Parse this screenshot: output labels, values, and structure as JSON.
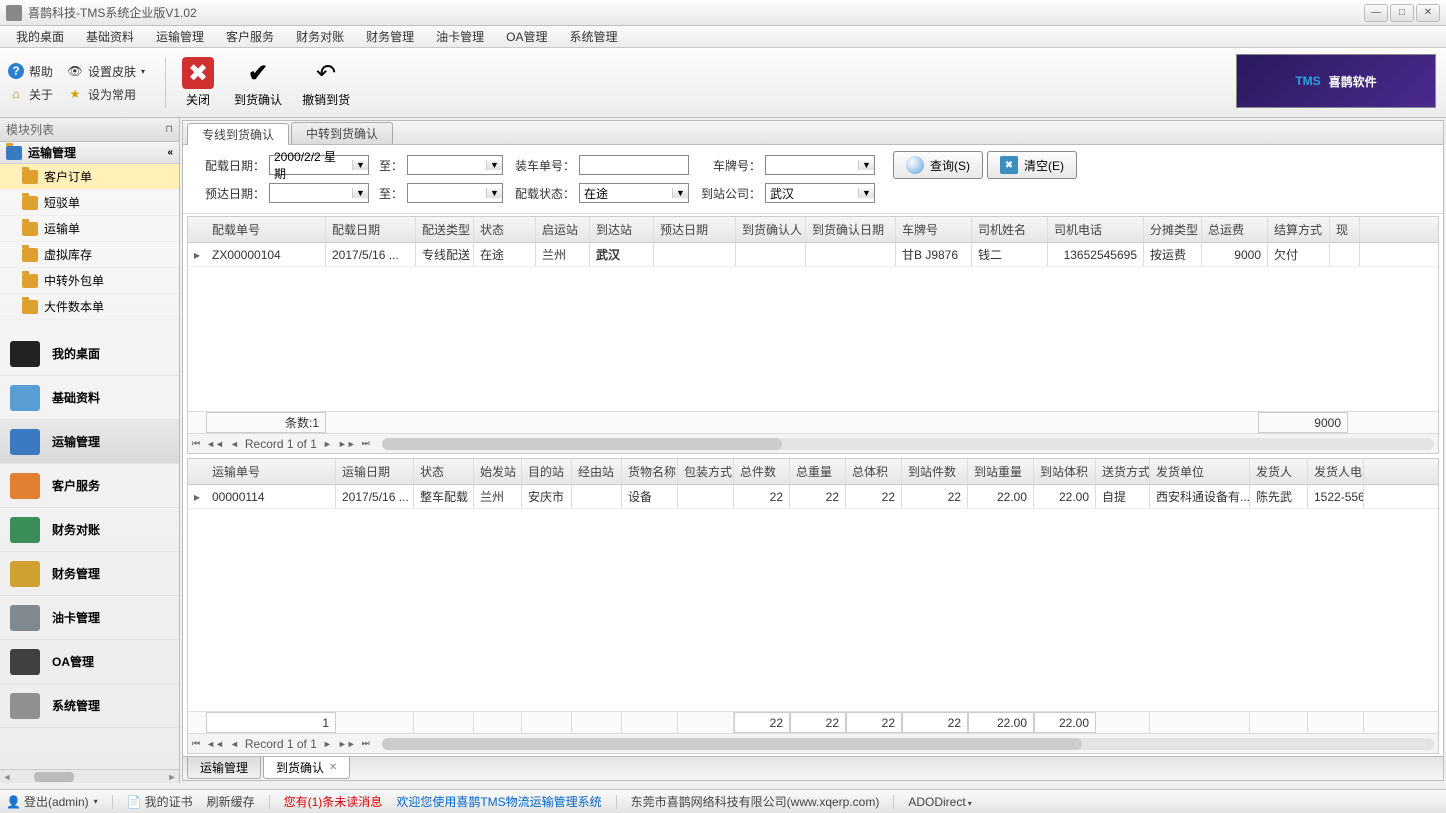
{
  "window": {
    "title": "喜鹊科技-TMS系统企业版V1.02"
  },
  "menubar": [
    "我的桌面",
    "基础资料",
    "运输管理",
    "客户服务",
    "财务对账",
    "财务管理",
    "油卡管理",
    "OA管理",
    "系统管理"
  ],
  "toolbar": {
    "help": "帮助",
    "skin": "设置皮肤",
    "about": "关于",
    "setCommon": "设为常用",
    "close": "关闭",
    "confirmArrive": "到货确认",
    "revokeArrive": "撤销到货",
    "logo_tms": "TMS",
    "logo_text": "喜鹊软件"
  },
  "sidebar": {
    "header": "模块列表",
    "expandedGroup": "运输管理",
    "tree": [
      "客户订单",
      "短驳单",
      "运输单",
      "虚拟库存",
      "中转外包单",
      "大件数本单"
    ],
    "treeSelected": 0,
    "bigNav": [
      {
        "label": "我的桌面",
        "color": "#222"
      },
      {
        "label": "基础资料",
        "color": "#5a9ed6"
      },
      {
        "label": "运输管理",
        "color": "#3a7ac0"
      },
      {
        "label": "客户服务",
        "color": "#e08030"
      },
      {
        "label": "财务对账",
        "color": "#3a8e5a"
      },
      {
        "label": "财务管理",
        "color": "#d0a030"
      },
      {
        "label": "油卡管理",
        "color": "#808890"
      },
      {
        "label": "OA管理",
        "color": "#404040"
      },
      {
        "label": "系统管理",
        "color": "#909090"
      }
    ],
    "bigNavSelected": 2
  },
  "tabs": {
    "items": [
      "专线到货确认",
      "中转到货确认"
    ],
    "active": 0
  },
  "form": {
    "labels": {
      "loadDate": "配载日期：",
      "to": "至：",
      "loadNo": "装车单号：",
      "plate": "车牌号：",
      "estDate": "预达日期：",
      "loadStatus": "配载状态：",
      "arriveCo": "到站公司："
    },
    "values": {
      "loadDateFrom": "2000/2/2 星期",
      "loadDateTo": "",
      "estFrom": "",
      "estTo": "",
      "loadNo": "",
      "plate": "",
      "loadStatus": "在途",
      "arriveCo": "武汉"
    },
    "btnSearch": "查询(S)",
    "btnClear": "清空(E)"
  },
  "grid1": {
    "headers": [
      "配载单号",
      "配载日期",
      "配送类型",
      "状态",
      "启运站",
      "到达站",
      "预达日期",
      "到货确认人",
      "到货确认日期",
      "车牌号",
      "司机姓名",
      "司机电话",
      "分摊类型",
      "总运费",
      "结算方式",
      "现"
    ],
    "widths": [
      120,
      90,
      58,
      62,
      54,
      64,
      82,
      70,
      90,
      76,
      76,
      96,
      58,
      66,
      62,
      30
    ],
    "rows": [
      {
        "cells": [
          "ZX00000104",
          "2017/5/16 ...",
          "专线配送",
          "在途",
          "兰州",
          "武汉",
          "",
          "",
          "",
          "甘B J9876",
          "钱二",
          "13652545695",
          "按运费",
          "9000",
          "欠付",
          ""
        ],
        "bold": [
          5
        ]
      }
    ],
    "summaryCount": "条数:1",
    "summaryTotal": "9000",
    "recordNav": "Record 1 of 1"
  },
  "grid2": {
    "headers": [
      "运输单号",
      "运输日期",
      "状态",
      "始发站",
      "目的站",
      "经由站",
      "货物名称",
      "包装方式",
      "总件数",
      "总重量",
      "总体积",
      "到站件数",
      "到站重量",
      "到站体积",
      "送货方式",
      "发货单位",
      "发货人",
      "发货人电"
    ],
    "widths": [
      130,
      78,
      60,
      48,
      50,
      50,
      56,
      56,
      56,
      56,
      56,
      66,
      66,
      62,
      54,
      100,
      58,
      56
    ],
    "rows": [
      {
        "cells": [
          "00000114",
          "2017/5/16 ...",
          "整车配载",
          "兰州",
          "安庆市",
          "",
          "设备",
          "",
          "22",
          "22",
          "22",
          "22",
          "22.00",
          "22.00",
          "自提",
          "西安科通设备有...",
          "陈先武",
          "1522-556"
        ]
      }
    ],
    "summaryRow": [
      "1",
      "",
      "",
      "",
      "",
      "",
      "",
      "",
      "22",
      "22",
      "22",
      "22",
      "22.00",
      "22.00",
      "",
      "",
      "",
      ""
    ],
    "recordNav": "Record 1 of 1"
  },
  "bottomTabs": {
    "items": [
      "运输管理",
      "到货确认"
    ],
    "active": 1
  },
  "statusbar": {
    "login": "登出(admin)",
    "cert": "我的证书",
    "refresh": "刷新缓存",
    "unread": "您有(1)条未读消息",
    "welcome": "欢迎您使用喜鹊TMS物流运输管理系统",
    "company": "东莞市喜鹊网络科技有限公司(www.xqerp.com)",
    "ado": "ADODirect"
  }
}
